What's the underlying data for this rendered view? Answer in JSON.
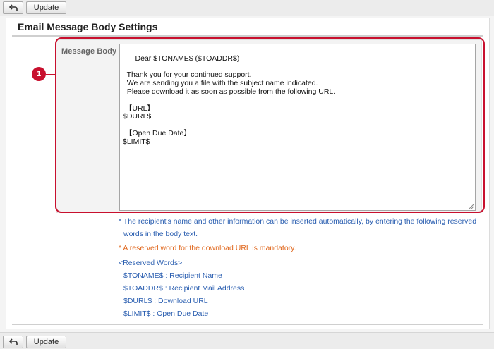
{
  "toolbar": {
    "update_label": "Update",
    "back_icon": "back-arrow-icon"
  },
  "section": {
    "title": "Email Message Body Settings"
  },
  "form": {
    "message_label": "Message Body :",
    "message_value": "Dear $TONAME$ ($TOADDR$)\n\n  Thank you for your continued support.\n  We are sending you a file with the subject name indicated.\n  Please download it as soon as possible from the following URL.\n\n 【URL】\n$DURL$\n\n 【Open Due Date】\n$LIMIT$"
  },
  "callout": {
    "number": "1",
    "color": "#c8102e"
  },
  "notes": {
    "line1": "* The recipient's name and other information can be inserted automatically, by entering the following reserved",
    "line2": "words in the body text.",
    "mandatory": "* A reserved word for the download URL is mandatory.",
    "reserved_header": "<Reserved Words>",
    "reserved": [
      "$TONAME$ : Recipient Name",
      "$TOADDR$ : Recipient Mail Address",
      "$DURL$ : Download URL",
      "$LIMIT$ : Open Due Date"
    ]
  },
  "colors": {
    "note_blue": "#2a5eb0",
    "note_orange": "#e0661b"
  }
}
